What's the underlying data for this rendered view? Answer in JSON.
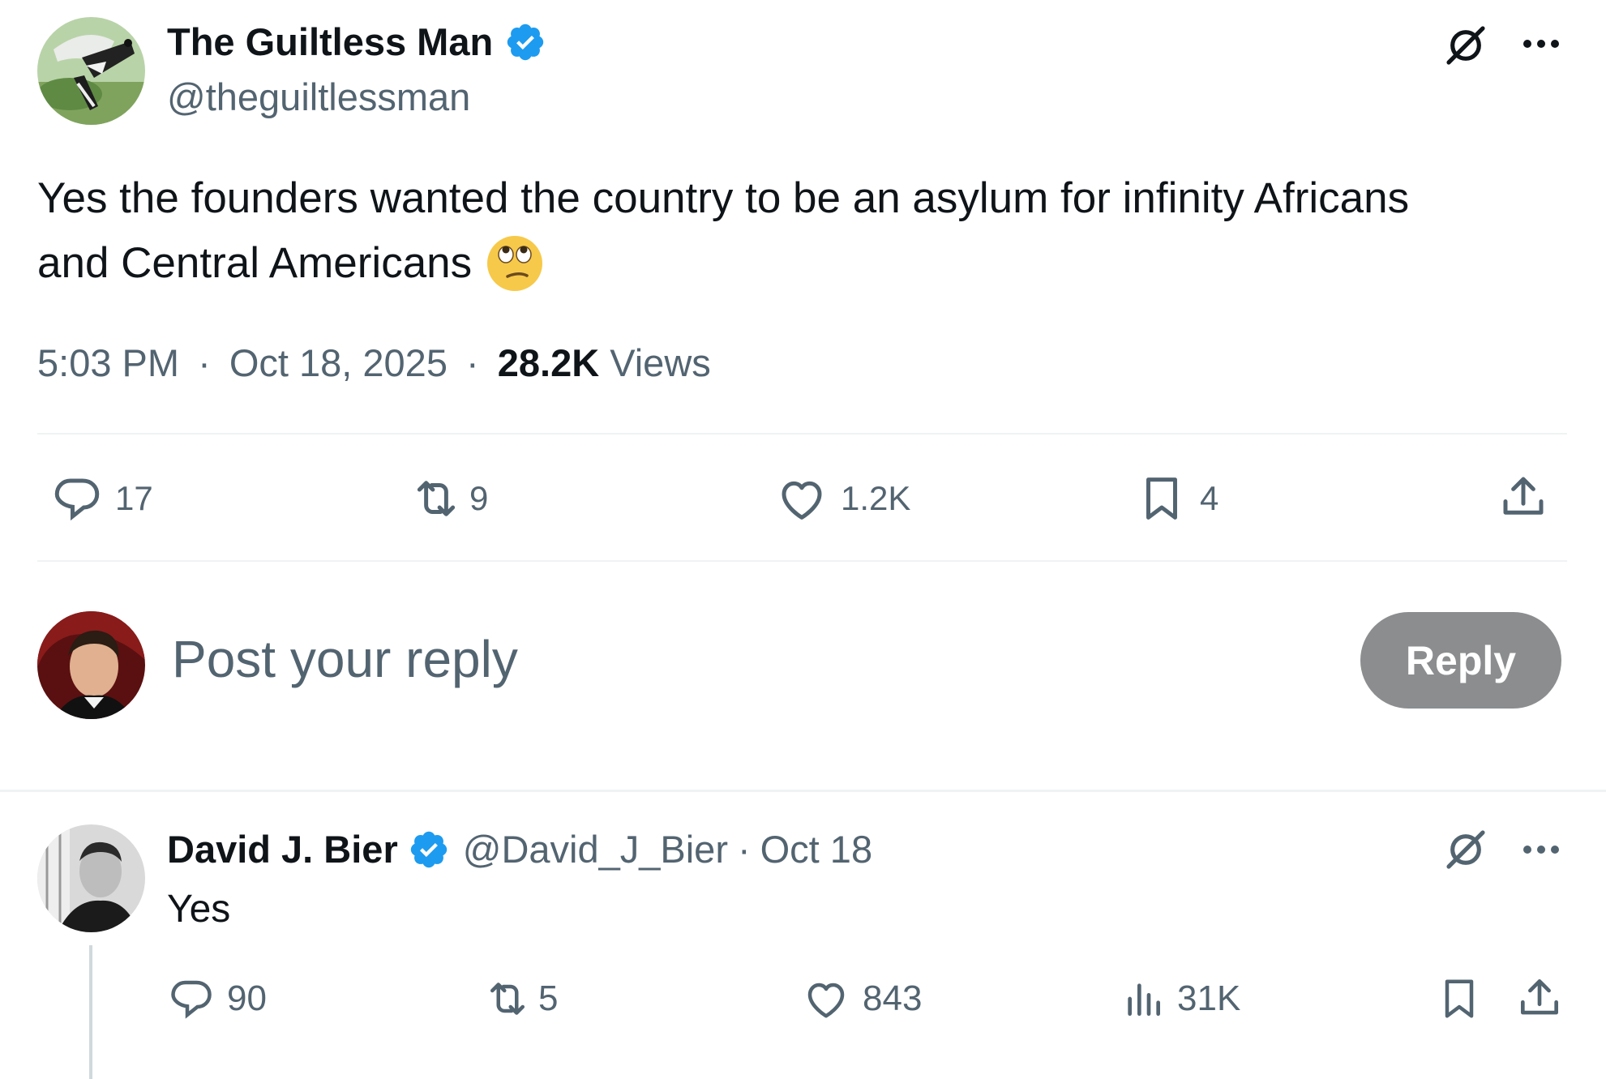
{
  "main_post": {
    "author_name": "The Guiltless Man",
    "handle": "@theguiltlessman",
    "text_line1": "Yes the founders wanted the country to be an asylum for infinity Africans",
    "text_line2": "and Central Americans",
    "time": "5:03 PM",
    "separator": "·",
    "date": "Oct 18, 2025",
    "views_count": "28.2K",
    "views_label": "Views",
    "replies": "17",
    "reposts": "9",
    "likes": "1.2K",
    "bookmarks": "4"
  },
  "composer": {
    "placeholder": "Post your reply",
    "reply_button": "Reply"
  },
  "reply_post": {
    "author_name": "David J. Bier",
    "handle": "@David_J_Bier",
    "separator": "·",
    "date": "Oct 18",
    "text": "Yes",
    "replies": "90",
    "reposts": "5",
    "likes": "843",
    "views": "31K"
  },
  "colors": {
    "verified": "#1d9bf0",
    "text": "#0f1419",
    "muted": "#536471",
    "reply_button_bg": "#8b8d8f"
  }
}
